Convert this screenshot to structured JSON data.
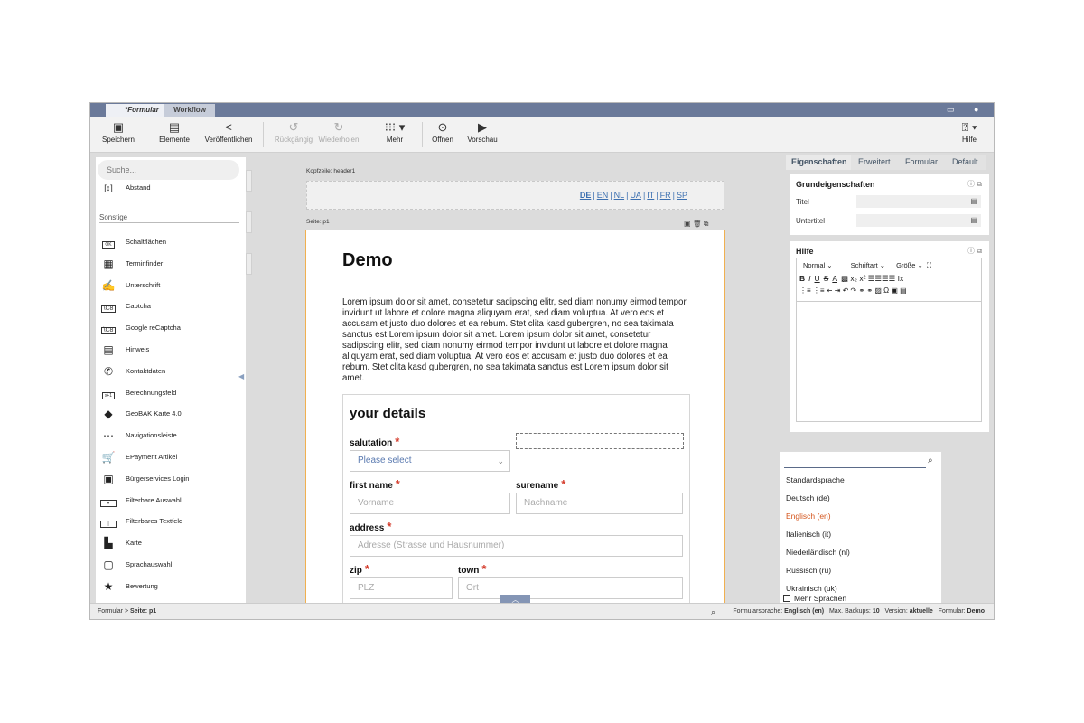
{
  "tabs": {
    "form": "*Formular",
    "workflow": "Workflow"
  },
  "titlebar": {
    "chat_icon": "chat-icon",
    "user_icon": "user-icon"
  },
  "toolbar": {
    "save": "Speichern",
    "elements": "Elemente",
    "publish": "Veröffentlichen",
    "undo": "Rückgängig",
    "redo": "Wiederholen",
    "more": "Mehr",
    "open": "Öffnen",
    "preview": "Vorschau",
    "help": "Hilfe"
  },
  "left": {
    "search_placeholder": "Suche...",
    "top_item": "Abstand",
    "section": "Sonstige",
    "items": [
      {
        "label": "Schaltflächen",
        "icon": "button-icon"
      },
      {
        "label": "Terminfinder",
        "icon": "calendar-icon"
      },
      {
        "label": "Unterschrift",
        "icon": "signature-icon"
      },
      {
        "label": "Captcha",
        "icon": "captcha-icon"
      },
      {
        "label": "Google reCaptcha",
        "icon": "recaptcha-icon"
      },
      {
        "label": "Hinweis",
        "icon": "note-icon"
      },
      {
        "label": "Kontaktdaten",
        "icon": "phone-icon"
      },
      {
        "label": "Berechnungsfeld",
        "icon": "calculation-icon"
      },
      {
        "label": "GeoBAK Karte 4.0",
        "icon": "germany-map-icon"
      },
      {
        "label": "Navigationsleiste",
        "icon": "navigation-icon"
      },
      {
        "label": "EPayment Artikel",
        "icon": "cart-icon"
      },
      {
        "label": "Bürgerservices Login",
        "icon": "id-card-icon"
      },
      {
        "label": "Filterbare Auswahl",
        "icon": "select-icon"
      },
      {
        "label": "Filterbares Textfeld",
        "icon": "textfield-icon"
      },
      {
        "label": "Karte",
        "icon": "map-icon"
      },
      {
        "label": "Sprachauswahl",
        "icon": "language-icon"
      },
      {
        "label": "Bewertung",
        "icon": "star-icon"
      }
    ]
  },
  "center": {
    "header_label": "Kopfzeile: header1",
    "page_label": "Seite: p1",
    "languages": [
      "DE",
      "EN",
      "NL",
      "UA",
      "IT",
      "FR",
      "SP"
    ],
    "page_title": "Demo",
    "lorem": "Lorem ipsum dolor sit amet, consetetur sadipscing elitr, sed diam nonumy eirmod tempor invidunt ut labore et dolore magna aliquyam erat, sed diam voluptua. At vero eos et accusam et justo duo dolores et ea rebum. Stet clita kasd gubergren, no sea takimata sanctus est Lorem ipsum dolor sit amet. Lorem ipsum dolor sit amet, consetetur sadipscing elitr, sed diam nonumy eirmod tempor invidunt ut labore et dolore magna aliquyam erat, sed diam voluptua. At vero eos et accusam et justo duo dolores et ea rebum. Stet clita kasd gubergren, no sea takimata sanctus est Lorem ipsum dolor sit amet.",
    "details_title": "your details",
    "fields": {
      "salutation": "salutation",
      "salutation_placeholder": "Please select",
      "first_name": "first name",
      "first_name_placeholder": "Vorname",
      "surename": "surename",
      "surename_placeholder": "Nachname",
      "address": "address",
      "address_placeholder": "Adresse (Strasse und Hausnummer)",
      "zip": "zip",
      "zip_placeholder": "PLZ",
      "town": "town",
      "town_placeholder": "Ort"
    }
  },
  "right": {
    "tabs": [
      "Eigenschaften",
      "Erweitert",
      "Formular",
      "Default"
    ],
    "basic_title": "Grundeigenschaften",
    "title_label": "Titel",
    "subtitle_label": "Untertitel",
    "help_title": "Hilfe",
    "editor": {
      "format": "Normal",
      "font": "Schriftart",
      "size": "Größe"
    }
  },
  "langdrop": {
    "options": [
      "Standardsprache",
      "Deutsch (de)",
      "Englisch (en)",
      "Italienisch (it)",
      "Niederländisch (nl)",
      "Russisch (ru)",
      "Ukrainisch (uk)"
    ],
    "selected_index": 2,
    "more": "Mehr Sprachen"
  },
  "status": {
    "breadcrumb_prefix": "Formular > ",
    "breadcrumb_page": "Seite: p1",
    "lang_label": "Formularsprache:",
    "lang_value": "Englisch (en)",
    "backups_label": "Max. Backups:",
    "backups_value": "10",
    "version_label": "Version:",
    "version_value": "aktuelle",
    "form_label": "Formular:",
    "form_value": "Demo"
  },
  "colors": {
    "accent": "#6b7a9a",
    "required": "#d43c2c",
    "selected_lang": "#d4551c",
    "page_border": "#f0b050"
  }
}
